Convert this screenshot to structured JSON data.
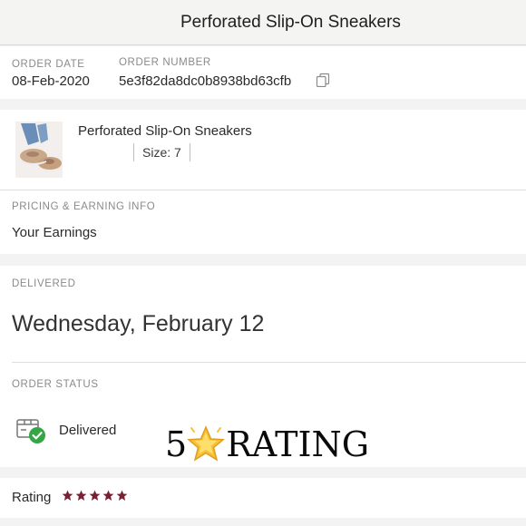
{
  "header": {
    "title": "Perforated Slip-On Sneakers"
  },
  "order": {
    "date_label": "ORDER DATE",
    "date_value": "08-Feb-2020",
    "number_label": "ORDER NUMBER",
    "number_value": "5e3f82da8dc0b8938bd63cfb",
    "copy_icon": "copy-icon"
  },
  "item": {
    "name": "Perforated Slip-On Sneakers",
    "size": "Size: 7",
    "thumbnail": "sneaker-thumbnail"
  },
  "pricing": {
    "section_label": "PRICING & EARNING INFO",
    "earnings_label": "Your Earnings"
  },
  "delivery": {
    "section_label": "DELIVERED",
    "date": "Wednesday, February 12"
  },
  "status": {
    "section_label": "ORDER STATUS",
    "value": "Delivered",
    "icon": "delivered-box-check-icon",
    "accent_color": "#35a546"
  },
  "overlay": {
    "number": "5",
    "text": "RATING",
    "icon": "star-icon"
  },
  "rating": {
    "label": "Rating",
    "stars": 5,
    "max": 5,
    "star_color": "#7a1f34"
  }
}
